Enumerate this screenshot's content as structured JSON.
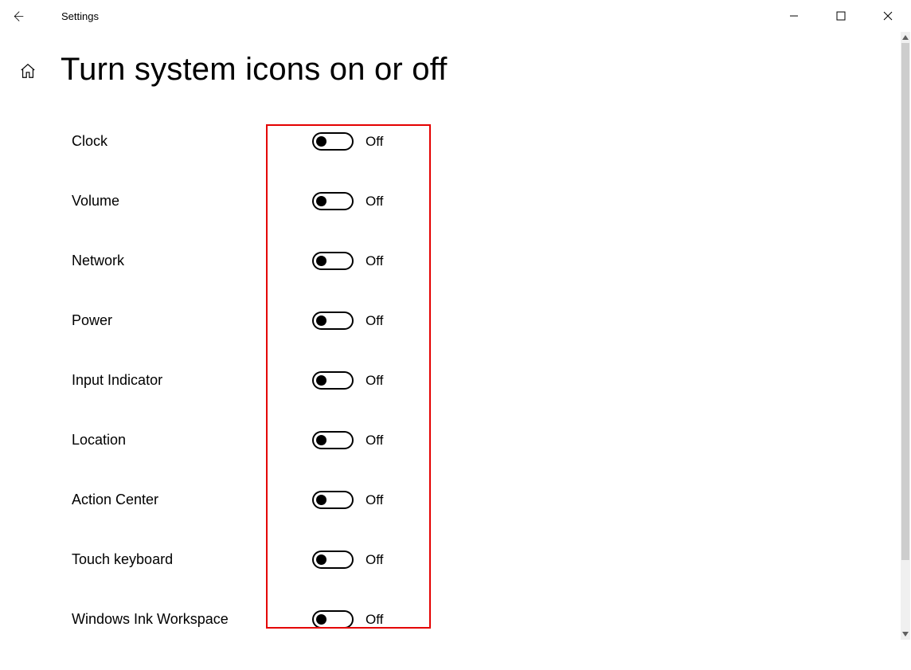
{
  "window": {
    "appTitle": "Settings"
  },
  "page": {
    "title": "Turn system icons on or off"
  },
  "labels": {
    "offState": "Off"
  },
  "settings": [
    {
      "label": "Clock",
      "state": "Off"
    },
    {
      "label": "Volume",
      "state": "Off"
    },
    {
      "label": "Network",
      "state": "Off"
    },
    {
      "label": "Power",
      "state": "Off"
    },
    {
      "label": "Input Indicator",
      "state": "Off"
    },
    {
      "label": "Location",
      "state": "Off"
    },
    {
      "label": "Action Center",
      "state": "Off"
    },
    {
      "label": "Touch keyboard",
      "state": "Off"
    },
    {
      "label": "Windows Ink Workspace",
      "state": "Off"
    }
  ]
}
